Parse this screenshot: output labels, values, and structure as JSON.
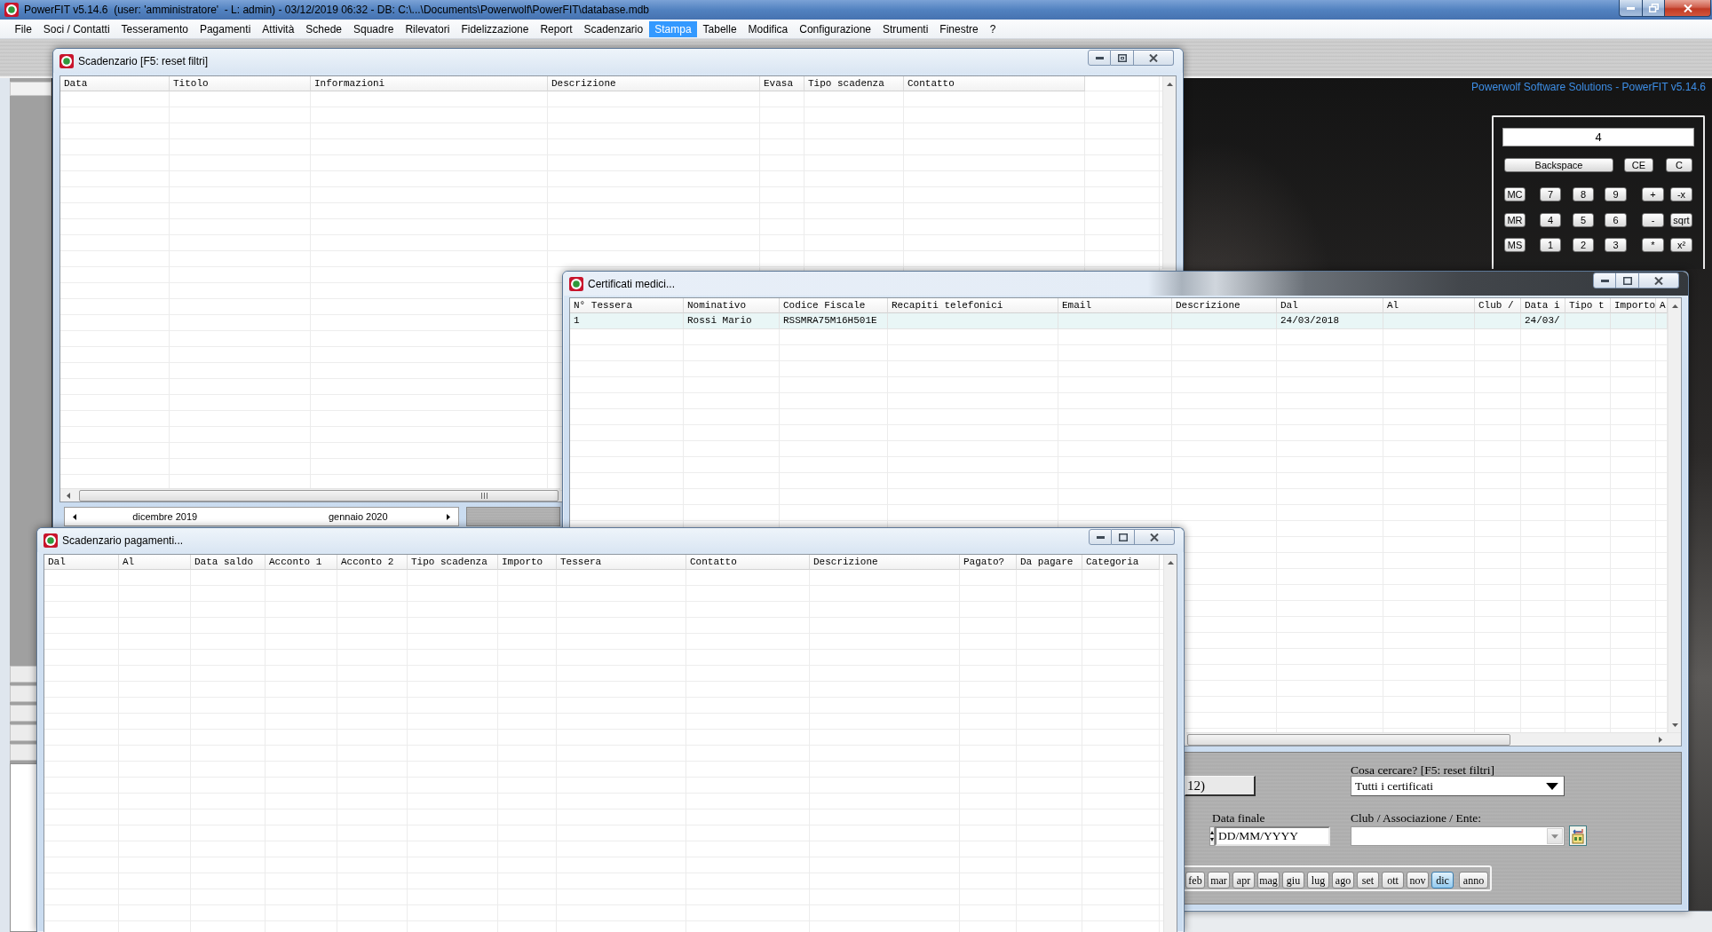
{
  "window": {
    "title": "PowerFIT v5.14.6  (user: 'amministratore'  - L: admin) - 03/12/2019 06:32 - DB: C:\\...\\Documents\\Powerwolf\\PowerFIT\\database.mdb"
  },
  "menu": [
    {
      "label": "File",
      "selected": false
    },
    {
      "label": "Soci / Contatti",
      "selected": false
    },
    {
      "label": "Tesseramento",
      "selected": false
    },
    {
      "label": "Pagamenti",
      "selected": false
    },
    {
      "label": "Attività",
      "selected": false
    },
    {
      "label": "Schede",
      "selected": false
    },
    {
      "label": "Squadre",
      "selected": false
    },
    {
      "label": "Rilevatori",
      "selected": false
    },
    {
      "label": "Fidelizzazione",
      "selected": false
    },
    {
      "label": "Report",
      "selected": false
    },
    {
      "label": "Scadenzario",
      "selected": false
    },
    {
      "label": "Stampa",
      "selected": true
    },
    {
      "label": "Tabelle",
      "selected": false
    },
    {
      "label": "Modifica",
      "selected": false
    },
    {
      "label": "Configurazione",
      "selected": false
    },
    {
      "label": "Strumenti",
      "selected": false
    },
    {
      "label": "Finestre",
      "selected": false
    },
    {
      "label": "?",
      "selected": false
    }
  ],
  "background": {
    "brand": "Powerwolf Software Solutions - PowerFIT v5.14.6"
  },
  "calculator": {
    "display": "4",
    "keys": [
      [
        "Backspace",
        "CE",
        "C"
      ],
      [
        "MC",
        "7",
        "8",
        "9",
        "+",
        "-x"
      ],
      [
        "MR",
        "4",
        "5",
        "6",
        "-",
        "sqrt"
      ],
      [
        "MS",
        "1",
        "2",
        "3",
        "*",
        "x²"
      ]
    ]
  },
  "scadenzario": {
    "title": "Scadenzario [F5: reset filtri]",
    "columns": [
      "Data",
      "Titolo",
      "Informazioni",
      "Descrizione",
      "Evasa",
      "Tipo scadenza",
      "Contatto"
    ],
    "calendar": [
      "dicembre 2019",
      "gennaio 2020"
    ]
  },
  "certificati": {
    "title": "Certificati medici...",
    "columns": [
      "N° Tessera",
      "Nominativo",
      "Codice Fiscale",
      "Recapiti telefonici",
      "Email",
      "Descrizione",
      "Dal",
      "Al",
      "Club /",
      "Data i",
      "Tipo t",
      "Importo",
      "A"
    ],
    "rows": [
      [
        "1",
        "Rossi Mario",
        "RSSMRA75M16H501E",
        null,
        null,
        null,
        "24/03/2018",
        null,
        null,
        "24/03/",
        null,
        null,
        null
      ]
    ],
    "filters": {
      "partial_button": "12)",
      "end_date": {
        "label": "Data finale",
        "placeholder": "DD/MM/YYYY"
      },
      "search": {
        "label": "Cosa cercare? [F5: reset filtri]",
        "value": "Tutti i certificati"
      },
      "club": {
        "label": "Club / Associazione / Ente:"
      },
      "periods": [
        {
          "kind": "month",
          "label": "feb",
          "selected": false
        },
        {
          "kind": "month",
          "label": "mar",
          "selected": false
        },
        {
          "kind": "month",
          "label": "apr",
          "selected": false
        },
        {
          "kind": "month",
          "label": "mag",
          "selected": false
        },
        {
          "kind": "month",
          "label": "giu",
          "selected": false
        },
        {
          "kind": "month",
          "label": "lug",
          "selected": false
        },
        {
          "kind": "month",
          "label": "ago",
          "selected": false
        },
        {
          "kind": "month",
          "label": "set",
          "selected": false
        },
        {
          "kind": "month",
          "label": "ott",
          "selected": false
        },
        {
          "kind": "month",
          "label": "nov",
          "selected": false
        },
        {
          "kind": "month",
          "label": "dic",
          "selected": true
        },
        {
          "kind": "year",
          "label": "anno",
          "selected": false
        }
      ]
    }
  },
  "pagamenti": {
    "title": "Scadenzario pagamenti...",
    "columns": [
      "Dal",
      "Al",
      "Data saldo",
      "Acconto 1",
      "Acconto 2",
      "Tipo scadenza",
      "Importo",
      "Tessera",
      "Contatto",
      "Descrizione",
      "Pagato?",
      "Da pagare",
      "Categoria"
    ]
  }
}
